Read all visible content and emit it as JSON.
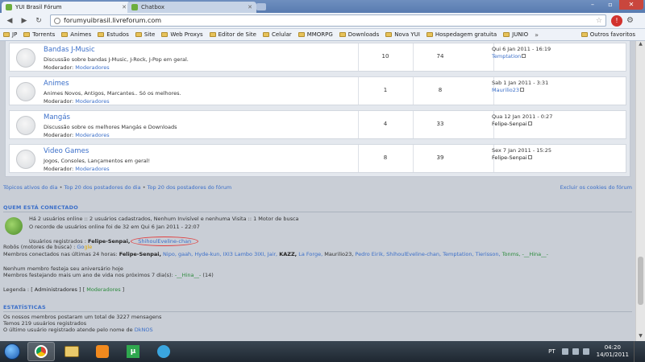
{
  "browser": {
    "tabs": [
      {
        "title": "YUI Brasil Fórum",
        "active": true
      },
      {
        "title": "Chatbox",
        "active": false
      }
    ],
    "url": "forumyuibrasil.livreforum.com",
    "bookmarks": [
      "JP",
      "Torrents",
      "Animes",
      "Estudos",
      "Site",
      "Web Proxys",
      "Editor de Site",
      "Celular",
      "MMORPG",
      "Downloads",
      "Nova YUI",
      "Hospedagem gratuita",
      "JUNIO"
    ],
    "other_bookmarks": "Outros favoritos"
  },
  "forums": [
    {
      "name": "Bandas J-Music",
      "desc": "Discussão sobre bandas J-Music, J-Rock, J-Pop em geral.",
      "mod_label": "Moderador:",
      "mod": "Moderadores",
      "topics": "10",
      "posts": "74",
      "last_date": "Qui 6 Jan 2011 - 16:19",
      "last_user": "Temptation"
    },
    {
      "name": "Animes",
      "desc": "Animes Novos, Antigos, Marcantes.. Só os melhores.",
      "mod_label": "Moderador:",
      "mod": "Moderadores",
      "topics": "1",
      "posts": "8",
      "last_date": "Sab 1 Jan 2011 - 3:31",
      "last_user": "Maurilio23"
    },
    {
      "name": "Mangás",
      "desc": "Discussão sobre os melhores Mangás e Downloads",
      "mod_label": "Moderador:",
      "mod": "Moderadores",
      "topics": "4",
      "posts": "33",
      "last_date": "Qua 12 Jan 2011 - 0:27",
      "last_user": "Felipe-Senpai"
    },
    {
      "name": "Video Games",
      "desc": "Jogos, Consoles, Lançamentos em geral!",
      "mod_label": "Moderador:",
      "mod": "Moderadores",
      "topics": "8",
      "posts": "39",
      "last_date": "Sex 7 Jan 2011 - 15:25",
      "last_user": "Felipe-Senpai"
    }
  ],
  "links": {
    "active_topics": "Tópicos ativos do dia",
    "top_day": "Top 20 dos postadores do dia",
    "top_forum": "Top 20 dos postadores do fórum",
    "sep": "•",
    "cookies": "Excluir os cookies do fórum"
  },
  "online": {
    "heading": "QUEM ESTÁ CONECTADO",
    "line1": "Há 2 usuários online :: 2 usuários cadastrados, Nenhum Invisível e nenhuma Visita :: 1 Motor de busca",
    "line2": "O recorde de usuários online foi de 32 em Qui 6 Jan 2011 - 22:07",
    "registered_label": "Usuários registrados :",
    "registered_user1": "Felipe-Senpai,",
    "registered_user2": "ShihoulEveline-chan",
    "bots_label": "Robôs (motores de busca) :",
    "bots_g": "Go",
    "bots_rest": "gle",
    "last24_label": "Membros conectados nas últimas 24 horas:",
    "last24_users": [
      {
        "name": "Felipe-Senpai,",
        "cls": "b"
      },
      {
        "name": "Nipo,",
        "cls": "u"
      },
      {
        "name": "gaah,",
        "cls": "u"
      },
      {
        "name": "Hyde-kun,",
        "cls": "u"
      },
      {
        "name": "IXI3 Lambo 3IXI,",
        "cls": "u"
      },
      {
        "name": "Jair,",
        "cls": "u"
      },
      {
        "name": "KAZZ,",
        "cls": "b"
      },
      {
        "name": "La Forge,",
        "cls": "u"
      },
      {
        "name": "Maurilio23,",
        "cls": "plain"
      },
      {
        "name": "Pedro Eirik,",
        "cls": "u"
      },
      {
        "name": "ShihoulEveline-chan,",
        "cls": "u"
      },
      {
        "name": "Temptation,",
        "cls": "u"
      },
      {
        "name": "Tierisson,",
        "cls": "u"
      },
      {
        "name": "Tonms,",
        "cls": "g"
      },
      {
        "name": "-__Hina__-",
        "cls": "g"
      }
    ],
    "birthday_today": "Nenhum membro festeja seu aniversário hoje",
    "birthday_next_prefix": "Membros festejando mais um ano de vida nos próximos 7 dia(s):",
    "birthday_next_user": "-__Hina__-",
    "birthday_next_suffix": "(14)",
    "legend_label": "Legenda :",
    "legend_admin": "Administradores",
    "legend_mods": "Moderadores"
  },
  "stats": {
    "heading": "ESTATÍSTICAS",
    "line1": "Os nossos membros postaram um total de 3227 mensagens",
    "line2": "Temos 219 usuários registrados",
    "line3_prefix": "O último usuário registrado atende pelo nome de",
    "line3_user": "DkNOS"
  },
  "taskbar": {
    "lang": "PT",
    "time": "04:20",
    "date": "14/01/2011"
  },
  "colors": {
    "accent": "#3b6fc9",
    "mod_green": "#2a8a3a",
    "circle_red": "#e04040"
  }
}
